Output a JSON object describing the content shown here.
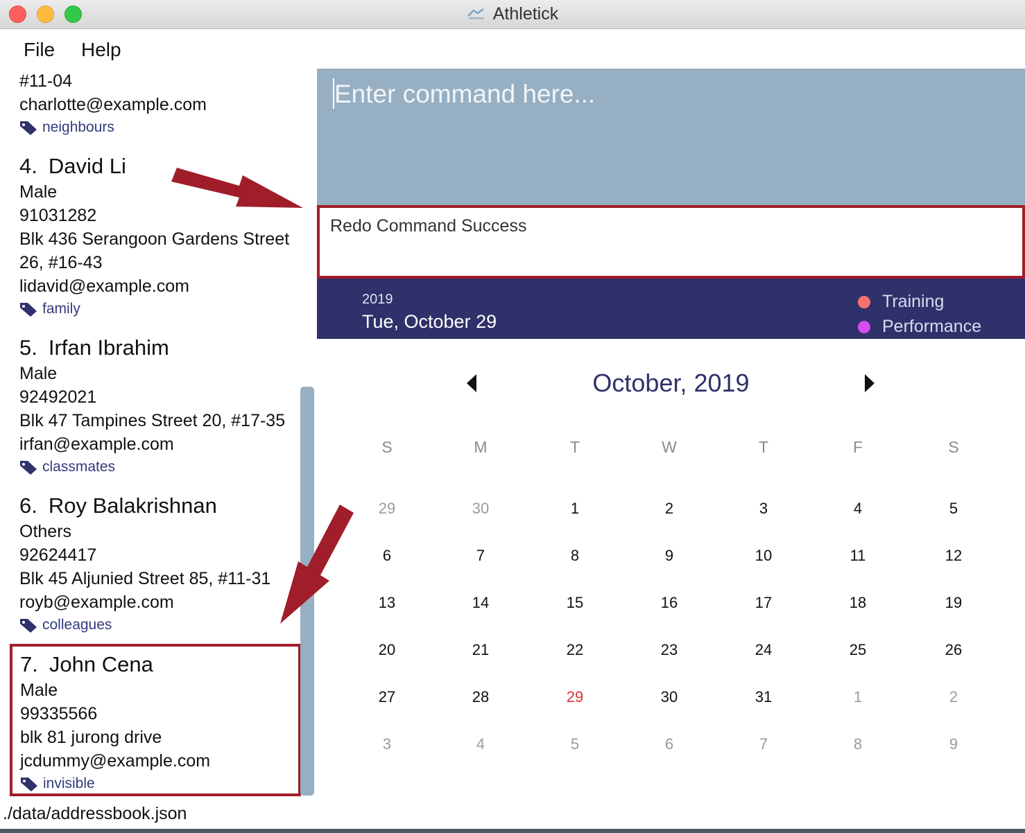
{
  "window": {
    "title": "Athletick"
  },
  "menu": {
    "file": "File",
    "help": "Help"
  },
  "persons": [
    {
      "address_tail": "#11-04",
      "email": "charlotte@example.com",
      "tag": "neighbours"
    },
    {
      "index": "4.",
      "name": "David Li",
      "gender": "Male",
      "phone": "91031282",
      "address1": "Blk 436 Serangoon Gardens Street",
      "address2": "26, #16-43",
      "email": "lidavid@example.com",
      "tag": "family"
    },
    {
      "index": "5.",
      "name": "Irfan Ibrahim",
      "gender": "Male",
      "phone": "92492021",
      "address1": "Blk 47 Tampines Street 20, #17-35",
      "email": "irfan@example.com",
      "tag": "classmates"
    },
    {
      "index": "6.",
      "name": "Roy Balakrishnan",
      "gender": "Others",
      "phone": "92624417",
      "address1": "Blk 45 Aljunied Street 85, #11-31",
      "email": "royb@example.com",
      "tag": "colleagues"
    },
    {
      "index": "7.",
      "name": "John Cena",
      "gender": "Male",
      "phone": "99335566",
      "address1": "blk 81 jurong drive",
      "email": "jcdummy@example.com",
      "tag": "invisible"
    }
  ],
  "command": {
    "placeholder": "Enter command here..."
  },
  "result": {
    "text": "Redo Command Success"
  },
  "date_bar": {
    "year": "2019",
    "full_date": "Tue, October 29"
  },
  "legend": [
    {
      "label": "Training",
      "color": "#f7726a"
    },
    {
      "label": "Performance",
      "color": "#d64ef2"
    }
  ],
  "calendar": {
    "month_title": "October, 2019",
    "weekdays": [
      "S",
      "M",
      "T",
      "W",
      "T",
      "F",
      "S"
    ],
    "weeks": [
      [
        {
          "d": "29",
          "muted": true
        },
        {
          "d": "30",
          "muted": true
        },
        {
          "d": "1"
        },
        {
          "d": "2"
        },
        {
          "d": "3"
        },
        {
          "d": "4"
        },
        {
          "d": "5"
        }
      ],
      [
        {
          "d": "6"
        },
        {
          "d": "7"
        },
        {
          "d": "8"
        },
        {
          "d": "9"
        },
        {
          "d": "10"
        },
        {
          "d": "11"
        },
        {
          "d": "12"
        }
      ],
      [
        {
          "d": "13"
        },
        {
          "d": "14"
        },
        {
          "d": "15"
        },
        {
          "d": "16"
        },
        {
          "d": "17"
        },
        {
          "d": "18"
        },
        {
          "d": "19"
        }
      ],
      [
        {
          "d": "20"
        },
        {
          "d": "21"
        },
        {
          "d": "22"
        },
        {
          "d": "23"
        },
        {
          "d": "24"
        },
        {
          "d": "25"
        },
        {
          "d": "26"
        }
      ],
      [
        {
          "d": "27"
        },
        {
          "d": "28"
        },
        {
          "d": "29",
          "today": true
        },
        {
          "d": "30"
        },
        {
          "d": "31"
        },
        {
          "d": "1",
          "muted": true
        },
        {
          "d": "2",
          "muted": true
        }
      ],
      [
        {
          "d": "3",
          "muted": true
        },
        {
          "d": "4",
          "muted": true
        },
        {
          "d": "5",
          "muted": true
        },
        {
          "d": "6",
          "muted": true
        },
        {
          "d": "7",
          "muted": true
        },
        {
          "d": "8",
          "muted": true
        },
        {
          "d": "9",
          "muted": true
        }
      ]
    ]
  },
  "status": {
    "path": "./data/addressbook.json"
  },
  "colors": {
    "accent": "#2f316a",
    "command_bg": "#97afc3",
    "highlight": "#a01d2a",
    "today": "#e03131"
  }
}
